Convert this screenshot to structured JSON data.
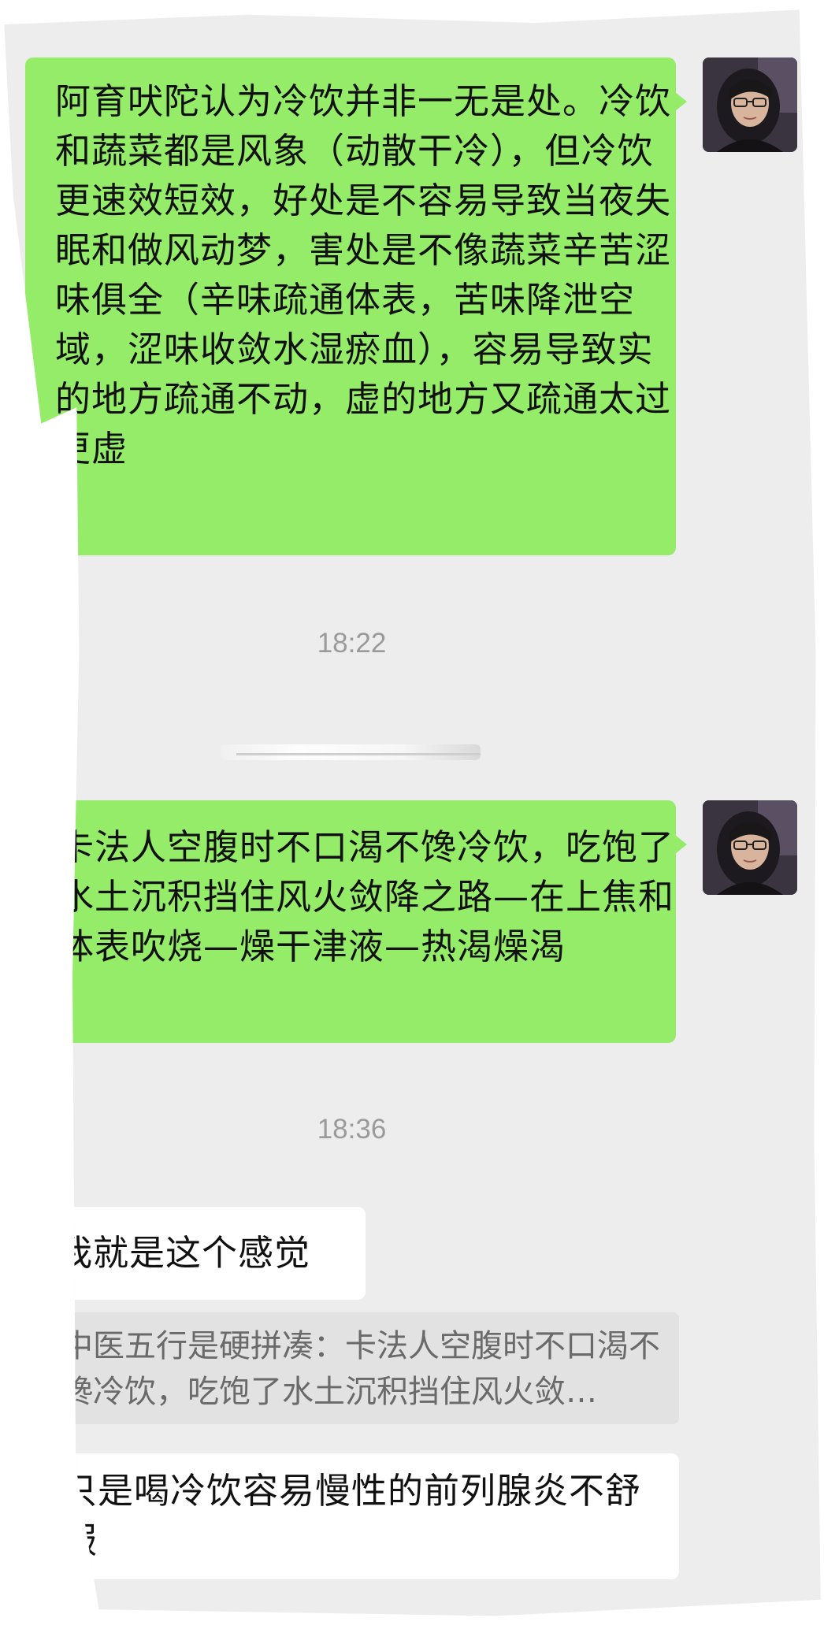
{
  "messages": [
    {
      "type": "sent",
      "text": "阿育吠陀认为冷饮并非一无是处。冷饮和蔬菜都是风象（动散干冷），但冷饮更速效短效，好处是不容易导致当夜失眠和做风动梦，害处是不像蔬菜辛苦涩味俱全（辛味疏通体表，苦味降泄空域，涩味收敛水湿瘀血），容易导致实的地方疏通不动，虚的地方又疏通太过更虚",
      "avatar_icon": "user-avatar-woman-glasses"
    },
    {
      "type": "timestamp",
      "text": "18:22"
    },
    {
      "type": "sent",
      "text": "卡法人空腹时不口渴不馋冷饮，吃饱了水土沉积挡住风火敛降之路—在上焦和体表吹烧—燥干津液—热渴燥渴",
      "avatar_icon": "user-avatar-woman-glasses"
    },
    {
      "type": "timestamp",
      "text": "18:36"
    },
    {
      "type": "received",
      "text": "我就是这个感觉"
    },
    {
      "type": "quote",
      "text": "中医五行是硬拼凑：卡法人空腹时不口渴不馋冷饮，吃饱了水土沉积挡住风火敛…"
    },
    {
      "type": "received",
      "text": "只是喝冷饮容易慢性的前列腺炎不舒服"
    }
  ],
  "colors": {
    "chat_background": "#ededed",
    "sent_bubble": "#95ec69",
    "received_bubble": "#ffffff",
    "quote_background": "#e2e2e2",
    "timestamp_text": "#9a9a9a"
  }
}
